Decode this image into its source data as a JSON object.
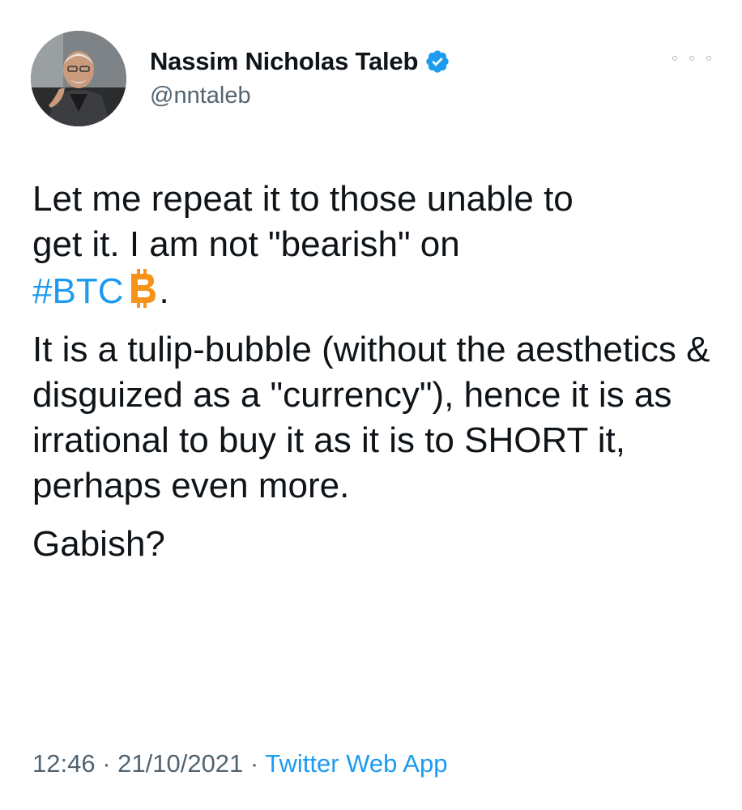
{
  "author": {
    "display_name": "Nassim Nicholas Taleb",
    "handle": "@nntaleb",
    "verified": true,
    "avatar_icon": "profile-photo"
  },
  "more_icon": "ellipsis-icon",
  "tweet": {
    "line1": "Let me repeat it to those unable to",
    "line2": "get it. I am not \"bearish\" on",
    "hashtag": "#BTC",
    "hashtag_suffix": ".",
    "emoji": "bitcoin-icon",
    "para2": "It is a tulip-bubble (without the aesthetics & disguized as a \"currency\"), hence it is as irrational to buy it as it is to SHORT it, perhaps even more.",
    "para3": "Gabish?"
  },
  "meta": {
    "time": "12:46",
    "separator": " · ",
    "date": "21/10/2021",
    "source": "Twitter Web App"
  },
  "colors": {
    "text": "#0f1419",
    "secondary": "#536471",
    "link": "#1d9bf0",
    "verified": "#1d9bf0",
    "bitcoin": "#f7931a"
  }
}
